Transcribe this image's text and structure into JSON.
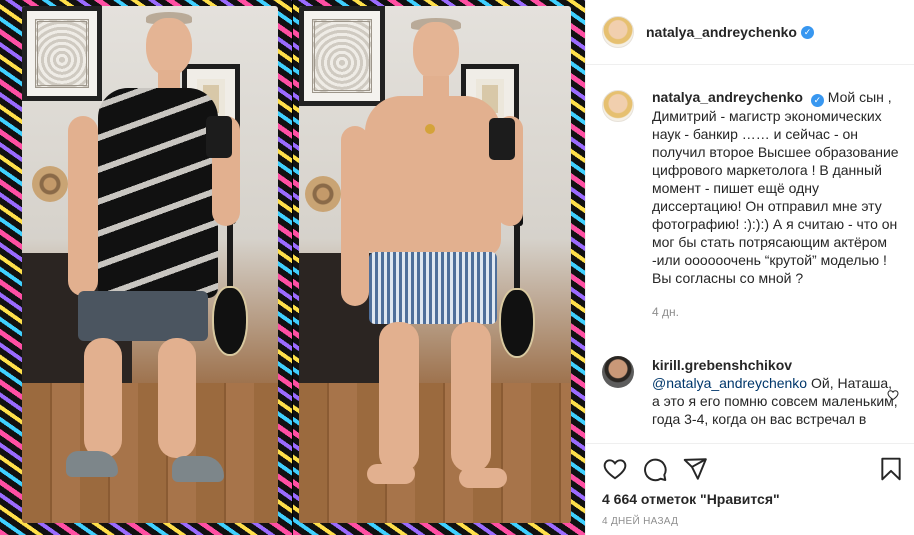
{
  "header": {
    "username": "natalya_andreychenko",
    "verified_mark": "✓"
  },
  "caption": {
    "username": "natalya_andreychenko",
    "text": "Мой сын , Димитрий - магистр экономических наук - банкир …… и сейчас - он получил второе Высшее образование цифрового маркетолога ! В данный момент - пишет ещё одну диссертацию! Он отправил мне эту фотографию! :):):) А я считаю - что он мог бы стать потрясающим актёром -или оооооочень “крутой” моделью ! Вы согласны со мной ?",
    "time": "4 дн."
  },
  "comment": {
    "username": "kirill.grebenshchikov",
    "mention": "@natalya_andreychenko",
    "text": " Ой, Наташа, а это я его помню совсем маленьким, года 3-4, когда он вас встречал в"
  },
  "actions": {
    "icons": [
      "heart-icon",
      "comment-icon",
      "share-icon",
      "bookmark-icon"
    ]
  },
  "likes": {
    "text": "4 664 отметок \"Нравится\""
  },
  "date": {
    "text": "4 ДНЕЙ НАЗАД"
  },
  "colors": {
    "accent": "#3897f0",
    "mention": "#00376b",
    "muted": "#8e8e8e",
    "text": "#262626"
  }
}
